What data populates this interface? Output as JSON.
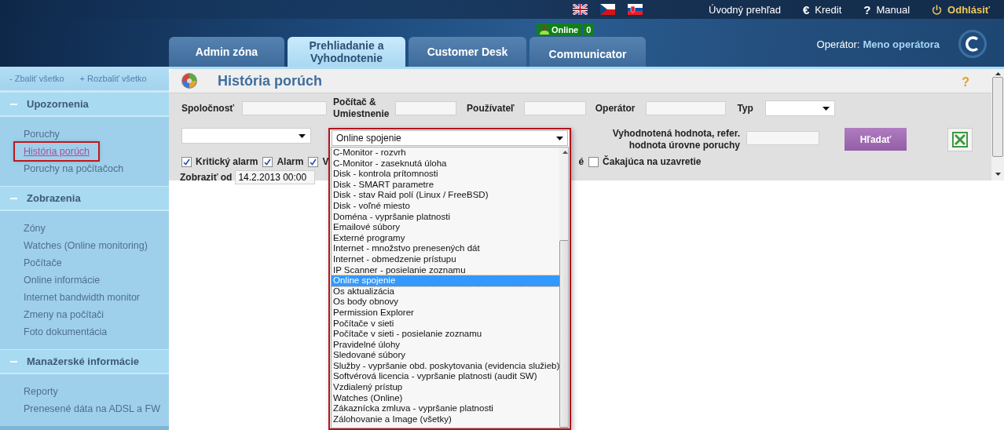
{
  "top_links": [
    {
      "kind": "home",
      "label": "Úvodný prehľad"
    },
    {
      "kind": "credit",
      "icon": "€",
      "label": "Kredit"
    },
    {
      "kind": "manual",
      "icon": "?",
      "label": "Manual"
    },
    {
      "kind": "logout",
      "label": "Odhlásiť"
    }
  ],
  "tabs": [
    {
      "label": "Admin zóna",
      "selected": false
    },
    {
      "label": "Prehliadanie a Vyhodnotenie",
      "selected": true
    },
    {
      "label": "Customer Desk",
      "selected": false
    },
    {
      "label": "Communicator",
      "selected": false,
      "badge": {
        "status": "Online",
        "count": "0"
      }
    }
  ],
  "operator": {
    "label": "Operátor:",
    "name": "Meno operátora"
  },
  "sidebar": {
    "collapse": {
      "icon": "-",
      "label": "Zbaliť všetko"
    },
    "expand": {
      "icon": "+",
      "label": "Rozbaliť všetko"
    },
    "sections": [
      {
        "title": "Upozornenia",
        "expanded": true,
        "items": [
          {
            "label": "Poruchy",
            "selected": false
          },
          {
            "label": "História porúch",
            "selected": true
          },
          {
            "label": "Poruchy na počítačoch",
            "selected": false
          }
        ]
      },
      {
        "title": "Zobrazenia",
        "expanded": true,
        "items": [
          {
            "label": "Zóny",
            "selected": false
          },
          {
            "label": "Watches (Online monitoring)",
            "selected": false
          },
          {
            "label": "Počítače",
            "selected": false
          },
          {
            "label": "Online informácie",
            "selected": false
          },
          {
            "label": "Internet bandwidth monitor",
            "selected": false
          },
          {
            "label": "Zmeny na počítači",
            "selected": false
          },
          {
            "label": "Foto dokumentácia",
            "selected": false
          }
        ]
      },
      {
        "title": "Manažerské informácie",
        "expanded": true,
        "items": [
          {
            "label": "Reporty",
            "selected": false
          },
          {
            "label": "Prenesené dáta na ADSL a FW",
            "selected": false
          }
        ]
      }
    ]
  },
  "page": {
    "title": "História porúch",
    "help": "?"
  },
  "filter": {
    "company_label": "Spoločnosť",
    "computer_label": "Počítač & Umiestnenie",
    "user_label": "Používateľ",
    "operator_label": "Operátor",
    "type_label": "Typ",
    "value_label": "Vyhodnotená hodnota, refer. hodnota úrovne poruchy",
    "search_button": "Hľadať",
    "combo": {
      "value": "Online spojenie",
      "open": true,
      "options": [
        {
          "label": "C-Monitor - rozvrh",
          "selected": false
        },
        {
          "label": "C-Monitor - zaseknutá úloha",
          "selected": false
        },
        {
          "label": "Disk - kontrola prítomnosti",
          "selected": false
        },
        {
          "label": "Disk - SMART parametre",
          "selected": false
        },
        {
          "label": "Disk - stav Raid polí (Linux / FreeBSD)",
          "selected": false
        },
        {
          "label": "Disk - voľné miesto",
          "selected": false
        },
        {
          "label": "Doména - vypršanie platnosti",
          "selected": false
        },
        {
          "label": "Emailové súbory",
          "selected": false
        },
        {
          "label": "Externé programy",
          "selected": false
        },
        {
          "label": "Internet - množstvo prenesených dát",
          "selected": false
        },
        {
          "label": "Internet - obmedzenie prístupu",
          "selected": false
        },
        {
          "label": "IP Scanner - posielanie zoznamu",
          "selected": false
        },
        {
          "label": "Online spojenie",
          "selected": true
        },
        {
          "label": "Os aktualizácia",
          "selected": false
        },
        {
          "label": "Os body obnovy",
          "selected": false
        },
        {
          "label": "Permission Explorer",
          "selected": false
        },
        {
          "label": "Počítače v sieti",
          "selected": false
        },
        {
          "label": "Počítače v sieti - posielanie zoznamu",
          "selected": false
        },
        {
          "label": "Pravidelné úlohy",
          "selected": false
        },
        {
          "label": "Sledované súbory",
          "selected": false
        },
        {
          "label": "Služby - vypršanie obd. poskytovania (evidencia služieb)",
          "selected": false
        },
        {
          "label": "Softvérová licencia - vypršanie platnosti (audit SW)",
          "selected": false
        },
        {
          "label": "Vzdialený prístup",
          "selected": false
        },
        {
          "label": "Watches (Online)",
          "selected": false
        },
        {
          "label": "Zákaznícka zmluva - vypršanie platnosti",
          "selected": false
        },
        {
          "label": "Zálohovanie a Image (všetky)",
          "selected": false
        }
      ]
    },
    "checks": [
      {
        "kind": "checkbox",
        "label": "Kritický alarm",
        "checked": true
      },
      {
        "kind": "checkbox",
        "label": "Alarm",
        "checked": true
      },
      {
        "kind": "checkbox",
        "label": "V",
        "checked": true
      },
      {
        "kind": "label",
        "label": "é"
      },
      {
        "kind": "checkbox",
        "label": "Čakajúca na uzavretie",
        "checked": false
      }
    ],
    "date_from_label": "Zobraziť od",
    "date_from": "14.2.2013 00:00"
  }
}
